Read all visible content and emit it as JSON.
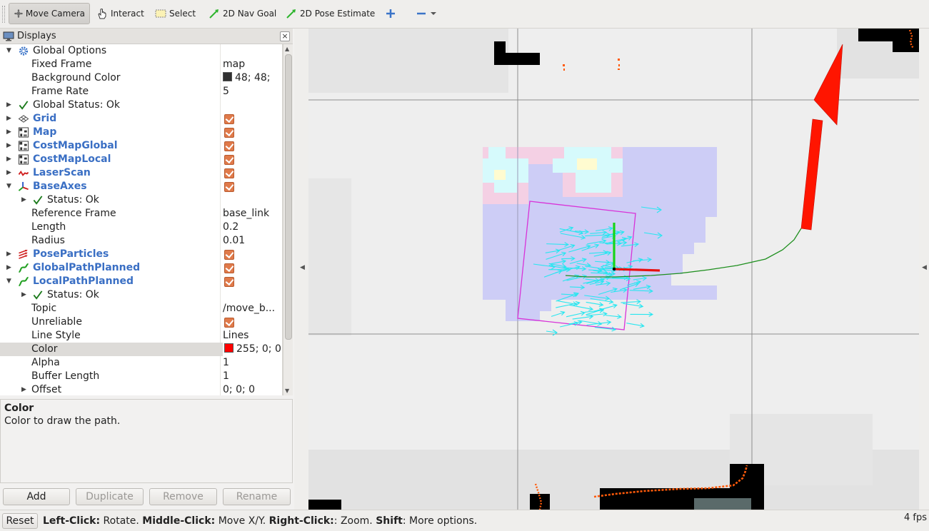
{
  "toolbar": {
    "move_camera": "Move Camera",
    "interact": "Interact",
    "select": "Select",
    "nav_goal": "2D Nav Goal",
    "pose_estimate": "2D Pose Estimate"
  },
  "displays": {
    "title": "Displays",
    "rows": [
      {
        "label": "Global Options"
      },
      {
        "label": "Fixed Frame",
        "value": "map"
      },
      {
        "label": "Background Color",
        "value": "48; 48; "
      },
      {
        "label": "Frame Rate",
        "value": "5"
      },
      {
        "label": "Global Status: Ok"
      },
      {
        "label": "Grid"
      },
      {
        "label": "Map"
      },
      {
        "label": "CostMapGlobal"
      },
      {
        "label": "CostMapLocal"
      },
      {
        "label": "LaserScan"
      },
      {
        "label": "BaseAxes"
      },
      {
        "label": "Status: Ok"
      },
      {
        "label": "Reference Frame",
        "value": "base_link"
      },
      {
        "label": "Length",
        "value": "0.2"
      },
      {
        "label": "Radius",
        "value": "0.01"
      },
      {
        "label": "PoseParticles"
      },
      {
        "label": "GlobalPathPlanned"
      },
      {
        "label": "LocalPathPlanned"
      },
      {
        "label": "Status: Ok"
      },
      {
        "label": "Topic",
        "value": "/move_b..."
      },
      {
        "label": "Unreliable"
      },
      {
        "label": "Line Style",
        "value": "Lines"
      },
      {
        "label": "Color",
        "value": "255; 0; 0"
      },
      {
        "label": "Alpha",
        "value": "1"
      },
      {
        "label": "Buffer Length",
        "value": "1"
      },
      {
        "label": "Offset",
        "value": "0; 0; 0"
      }
    ]
  },
  "description": {
    "title": "Color",
    "text": "Color to draw the path."
  },
  "buttons": {
    "add": "Add",
    "duplicate": "Duplicate",
    "remove": "Remove",
    "rename": "Rename"
  },
  "status": {
    "reset": "Reset",
    "hint_1b": "Left-Click:",
    "hint_1": " Rotate. ",
    "hint_2b": "Middle-Click:",
    "hint_2": " Move X/Y. ",
    "hint_3b": "Right-Click:",
    "hint_3": ": Zoom. ",
    "hint_4b": "Shift",
    "hint_4": ": More options.",
    "fps": "4 fps"
  },
  "colors": {
    "background_swatch": "#303030",
    "path_color_swatch": "#ff0000",
    "display_name": "#3a6fc4",
    "checkbox": "#e07a4a"
  }
}
